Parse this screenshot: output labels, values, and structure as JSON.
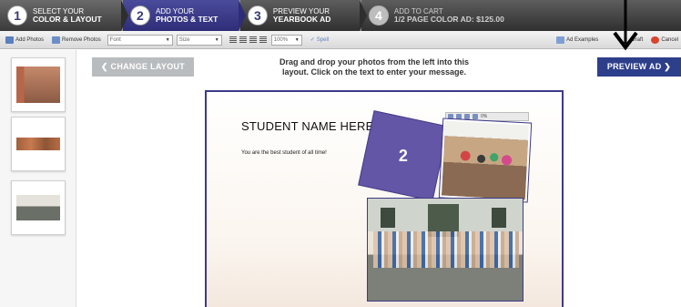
{
  "steps": [
    {
      "num": "1",
      "line1": "SELECT YOUR",
      "line2": "COLOR & LAYOUT"
    },
    {
      "num": "2",
      "line1": "ADD YOUR",
      "line2": "PHOTOS & TEXT"
    },
    {
      "num": "3",
      "line1": "PREVIEW YOUR",
      "line2": "YEARBOOK AD"
    },
    {
      "num": "4",
      "line1": "ADD TO CART",
      "line2": "1/2 PAGE COLOR AD: $125.00"
    }
  ],
  "toolbar": {
    "add_photos": "Add Photos",
    "remove_photos": "Remove Photos",
    "font_value": "Font",
    "size_value": "Size",
    "zoom_value": "100%",
    "spell": "Spell",
    "ad_examples": "Ad Examples",
    "draft": "Draft",
    "cancel": "Cancel"
  },
  "main": {
    "change_layout": "❮  CHANGE LAYOUT",
    "instructions_1": "Drag and drop your photos from the left into this",
    "instructions_2": "layout. Click on the text to enter your message.",
    "preview_ad": "PREVIEW AD  ❯"
  },
  "canvas": {
    "student_name": "STUDENT NAME HERE",
    "message": "You are the best student of all time!",
    "slot_number": "2",
    "photo_toolbar_zoom": "0%"
  },
  "colors": {
    "active_step": "#2d2d78",
    "preview_button": "#2d3e8a",
    "canvas_border": "#3d3a8a",
    "slot_fill": "#5b4ea3"
  }
}
